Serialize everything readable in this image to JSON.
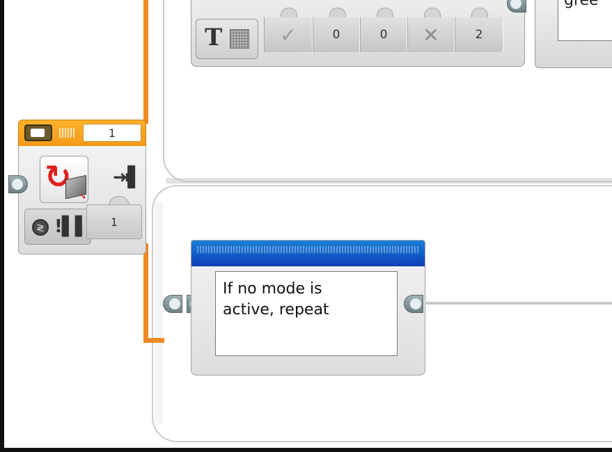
{
  "display_block": {
    "mode_icon": "text-grid-icon",
    "params": [
      {
        "name": "clear-screen",
        "icon": "check-icon"
      },
      {
        "name": "x",
        "value": "0"
      },
      {
        "name": "y",
        "value": "0"
      },
      {
        "name": "color",
        "icon": "x-icon"
      },
      {
        "name": "font",
        "value": "2"
      }
    ]
  },
  "top_right_block": {
    "text": "gree"
  },
  "loop_interrupt_block": {
    "header_value": "1",
    "mode_icon": "loop-interrupt-icon",
    "end_icon": "end-bars-icon",
    "sub_mode_icon": "compare-gauge-icon",
    "output_value": "1"
  },
  "comment_block": {
    "text": "If no mode is\nactive, repeat"
  },
  "colors": {
    "sequence_wire": "#f08a24",
    "comment_header": "#0c3fb8",
    "switch_header": "#f29a18"
  }
}
